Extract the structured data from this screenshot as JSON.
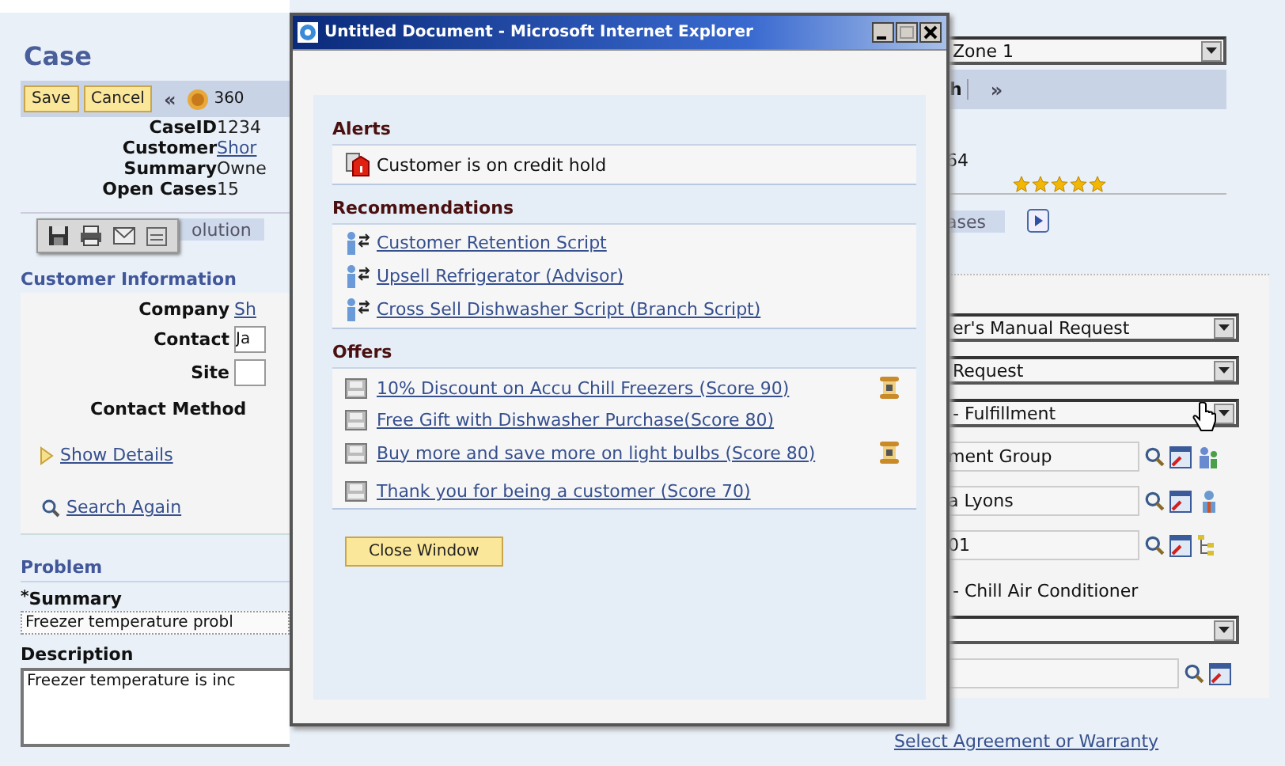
{
  "page": {
    "title": "Case"
  },
  "toolbar": {
    "buttons": [
      "Save",
      "Cancel"
    ],
    "nav": "«",
    "partial": "360"
  },
  "case_fields": [
    {
      "label": "CaseID",
      "value": "1234",
      "link": false
    },
    {
      "label": "Customer",
      "value": "Shor",
      "link": true
    },
    {
      "label": "Summary",
      "value": "Owne",
      "link": false
    },
    {
      "label": "Open Cases",
      "value": "15",
      "link": false
    }
  ],
  "tabs": [
    {
      "label": "olution",
      "selected": false
    }
  ],
  "customer_info": {
    "heading": "Customer Information",
    "company_label": "Company",
    "company_value": "Sh",
    "contact_label": "Contact",
    "contact_value": "Ja",
    "site_label": "Site",
    "contact_method": "Contact Method",
    "show_details": "Show Details",
    "search_again": "Search Again"
  },
  "problem": {
    "heading": "Problem",
    "required_mark": "*",
    "summary_label": "Summary",
    "summary_value": "Freezer temperature probl",
    "description_label": "Description",
    "description_value": "Freezer temperature is inc"
  },
  "right": {
    "zone": "Zone 1",
    "toolbar_text": "h",
    "nav": "»",
    "number": "64",
    "stars": 5,
    "tab": "ases",
    "selects": [
      "er's Manual Request",
      "Request",
      "- Fulfillment"
    ],
    "inputs": [
      {
        "value": "ment Group",
        "kind": "group"
      },
      {
        "value": "a Lyons",
        "kind": "person"
      },
      {
        "value": "01",
        "kind": "tree"
      }
    ],
    "product": "- Chill Air Conditioner",
    "link": "Select Agreement or Warranty"
  },
  "popup": {
    "title": "Untitled Document - Microsoft Internet Explorer",
    "alerts_heading": "Alerts",
    "alerts": [
      "Customer is on credit hold"
    ],
    "recommendations_heading": "Recommendations",
    "recommendations": [
      "Customer Retention Script",
      "Upsell Refrigerator (Advisor)",
      "Cross Sell Dishwasher Script (Branch Script)"
    ],
    "offers_heading": "Offers",
    "offers": [
      {
        "label": "10% Discount on Accu Chill Freezers (Score 90)",
        "flagged": true
      },
      {
        "label": "Free Gift with Dishwasher Purchase(Score 80)",
        "flagged": false
      },
      {
        "label": "Buy more and save more on light bulbs (Score 80)",
        "flagged": true
      },
      {
        "label": "Thank you for being a customer (Score 70)",
        "flagged": false
      }
    ],
    "close_button": "Close Window"
  }
}
